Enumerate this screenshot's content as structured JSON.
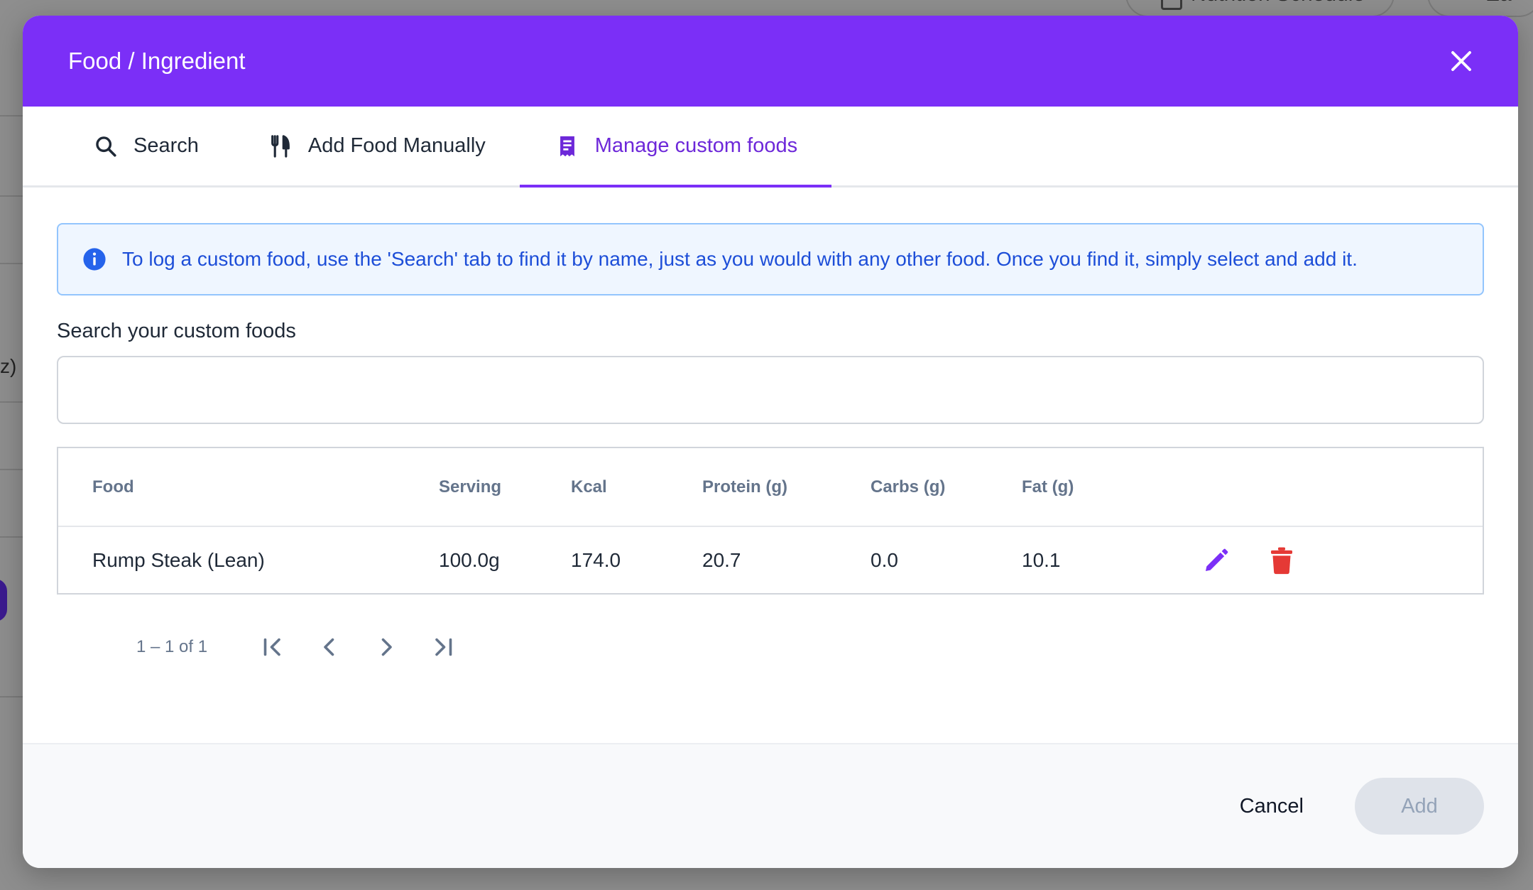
{
  "background": {
    "chip_1": "Nutrition Schedule",
    "chip_2": "Ea",
    "side_text": "z)"
  },
  "modal": {
    "title": "Food / Ingredient",
    "header_color": "#7b2ff7"
  },
  "tabs": [
    {
      "label": "Search",
      "icon": "search-icon",
      "active": false
    },
    {
      "label": "Add Food Manually",
      "icon": "cutlery-icon",
      "active": false
    },
    {
      "label": "Manage custom foods",
      "icon": "receipt-icon",
      "active": true
    }
  ],
  "info": {
    "text": "To log a custom food, use the 'Search' tab to find it by name, just as you would with any other food. Once you find it, simply select and add it."
  },
  "search": {
    "label": "Search your custom foods",
    "value": "",
    "placeholder": ""
  },
  "table": {
    "headers": {
      "food": "Food",
      "serving": "Serving",
      "kcal": "Kcal",
      "protein": "Protein (g)",
      "carbs": "Carbs (g)",
      "fat": "Fat (g)"
    },
    "rows": [
      {
        "food": "Rump Steak (Lean)",
        "serving": "100.0g",
        "kcal": "174.0",
        "protein": "20.7",
        "carbs": "0.0",
        "fat": "10.1"
      }
    ]
  },
  "pagination": {
    "range": "1 – 1 of 1"
  },
  "footer": {
    "cancel_label": "Cancel",
    "add_label": "Add"
  },
  "colors": {
    "accent": "#7b2ff7",
    "edit_icon": "#7b2ff7",
    "delete_icon": "#e53935",
    "info_text": "#1d4ed8"
  }
}
